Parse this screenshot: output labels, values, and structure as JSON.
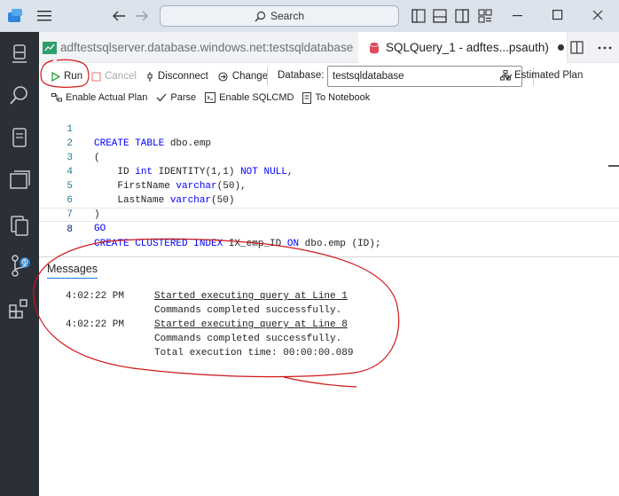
{
  "titlebar": {
    "search_label": "Search"
  },
  "tabs": {
    "inactive_label": "adftestsqlserver.database.windows.net:testsqldatabase",
    "active_label": "SQLQuery_1 - adftes...psauth)"
  },
  "toolbar": {
    "run": "Run",
    "cancel": "Cancel",
    "disconnect": "Disconnect",
    "change": "Change",
    "database_label": "Database:",
    "database_value": "testsqldatabase",
    "estimated_plan": "Estimated Plan",
    "enable_actual_plan": "Enable Actual Plan",
    "parse": "Parse",
    "enable_sqlcmd": "Enable SQLCMD",
    "to_notebook": "To Notebook"
  },
  "editor": {
    "line_numbers": [
      "1",
      "2",
      "3",
      "4",
      "5",
      "6",
      "7",
      "8"
    ],
    "lines": [
      "CREATE TABLE dbo.emp",
      "(",
      "    ID int IDENTITY(1,1) NOT NULL,",
      "    FirstName varchar(50),",
      "    LastName varchar(50)",
      ")",
      "GO",
      "CREATE CLUSTERED INDEX IX_emp_ID ON dbo.emp (ID);"
    ]
  },
  "activity_badge": "1",
  "messages": {
    "header": "Messages",
    "rows": [
      {
        "time": "4:02:22 PM",
        "text": "Started executing query at Line 1"
      },
      {
        "time": "",
        "text": "Commands completed successfully."
      },
      {
        "time": "4:02:22 PM",
        "text": "Started executing query at Line 8"
      },
      {
        "time": "",
        "text": "Commands completed successfully."
      },
      {
        "time": "",
        "text": "Total execution time: 00:00:00.089"
      }
    ]
  },
  "colors": {
    "keyword": "#0000ff",
    "line_number": "#237893",
    "run_green": "#2e9e3a",
    "annotation_red": "#d01818",
    "activity_bar": "#2b2f36"
  }
}
